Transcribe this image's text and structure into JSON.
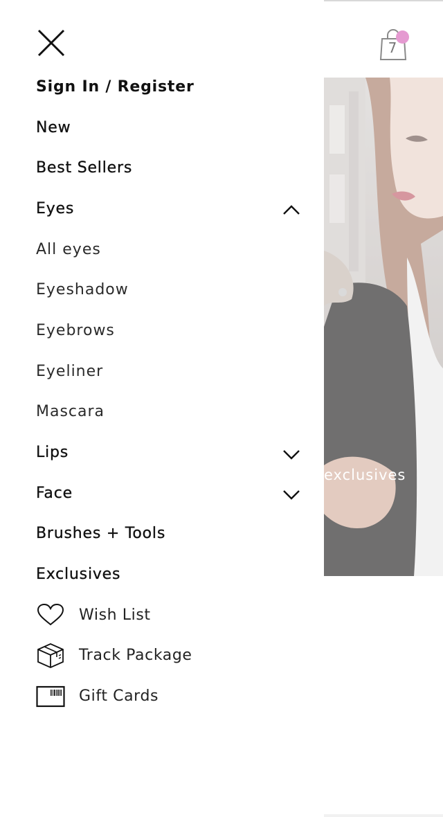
{
  "drawer": {
    "sign_in": "Sign In / Register",
    "items": [
      {
        "label": "New",
        "weight": "medium",
        "expandable": false
      },
      {
        "label": "Best Sellers",
        "weight": "medium",
        "expandable": false
      },
      {
        "label": "Eyes",
        "weight": "medium",
        "expandable": true,
        "expanded": true,
        "chevron": "chevron-up-icon"
      },
      {
        "label": "All eyes",
        "weight": "sub"
      },
      {
        "label": "Eyeshadow",
        "weight": "sub"
      },
      {
        "label": "Eyebrows",
        "weight": "sub"
      },
      {
        "label": "Eyeliner",
        "weight": "sub"
      },
      {
        "label": "Mascara",
        "weight": "sub"
      },
      {
        "label": "Lips",
        "weight": "medium",
        "expandable": true,
        "expanded": false,
        "chevron": "chevron-down-icon"
      },
      {
        "label": "Face",
        "weight": "medium",
        "expandable": true,
        "expanded": false,
        "chevron": "chevron-down-icon"
      },
      {
        "label": "Brushes + Tools",
        "weight": "medium",
        "expandable": false
      },
      {
        "label": "Exclusives",
        "weight": "medium",
        "expandable": false
      }
    ],
    "utility": [
      {
        "label": "Wish List",
        "icon": "heart-icon"
      },
      {
        "label": "Track Package",
        "icon": "package-icon"
      },
      {
        "label": "Gift Cards",
        "icon": "gift-card-icon"
      }
    ]
  },
  "background": {
    "cart_count": "7",
    "hero_caption": "exclusives"
  },
  "colors": {
    "cart_badge": "#e59ad1",
    "text": "#111111"
  }
}
